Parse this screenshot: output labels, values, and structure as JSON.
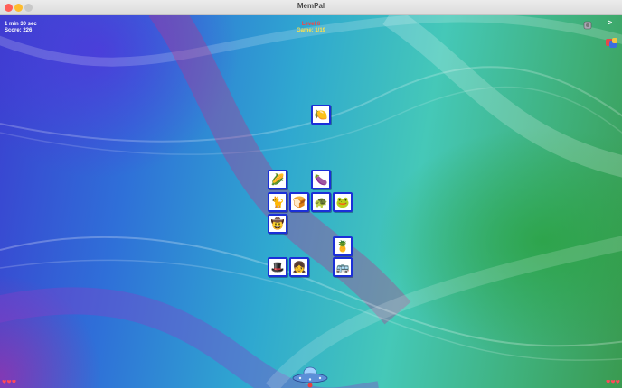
{
  "window": {
    "title": "MemPal"
  },
  "hud": {
    "timer": "1 min 30 sec",
    "score": "Score: 226",
    "level": "Level 6",
    "game": "Game: 1/19"
  },
  "controls": {
    "next_label": ">",
    "sound_icon": "speaker-icon",
    "palette_icon": "color-palette-icon",
    "ufo_icon": "ufo-icon"
  },
  "tiles": [
    {
      "name": "tile-lemon-face",
      "glyph": "🍋"
    },
    {
      "name": "tile-corn",
      "glyph": "🌽"
    },
    {
      "name": "tile-eggplant",
      "glyph": "🍆"
    },
    {
      "name": "tile-cat",
      "glyph": "🐈"
    },
    {
      "name": "tile-bread",
      "glyph": "🍞"
    },
    {
      "name": "tile-turtle",
      "glyph": "🐢"
    },
    {
      "name": "tile-frog",
      "glyph": "🐸"
    },
    {
      "name": "tile-cowboy",
      "glyph": "🤠"
    },
    {
      "name": "tile-pineapple",
      "glyph": "🍍"
    },
    {
      "name": "tile-man-hat",
      "glyph": "🎩"
    },
    {
      "name": "tile-girl",
      "glyph": "👧"
    },
    {
      "name": "tile-bus",
      "glyph": "🚌"
    }
  ],
  "lives": {
    "left": "♥♥♥",
    "right": "♥♥♥",
    "color": "#ff4a5a"
  },
  "colors": {
    "tile_border": "#1b2fd8",
    "level_text": "#ff4040",
    "game_text": "#ffe24a"
  }
}
